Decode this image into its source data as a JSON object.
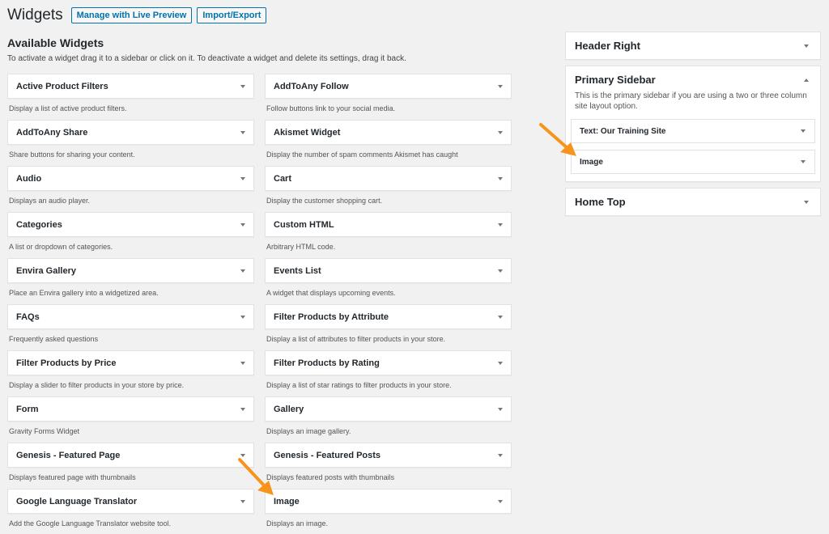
{
  "header": {
    "title": "Widgets",
    "manage_live_preview": "Manage with Live Preview",
    "import_export": "Import/Export"
  },
  "available": {
    "title": "Available Widgets",
    "description": "To activate a widget drag it to a sidebar or click on it. To deactivate a widget and delete its settings, drag it back.",
    "widgets": [
      {
        "title": "Active Product Filters",
        "desc": "Display a list of active product filters."
      },
      {
        "title": "AddToAny Follow",
        "desc": "Follow buttons link to your social media."
      },
      {
        "title": "AddToAny Share",
        "desc": "Share buttons for sharing your content."
      },
      {
        "title": "Akismet Widget",
        "desc": "Display the number of spam comments Akismet has caught"
      },
      {
        "title": "Audio",
        "desc": "Displays an audio player."
      },
      {
        "title": "Cart",
        "desc": "Display the customer shopping cart."
      },
      {
        "title": "Categories",
        "desc": "A list or dropdown of categories."
      },
      {
        "title": "Custom HTML",
        "desc": "Arbitrary HTML code."
      },
      {
        "title": "Envira Gallery",
        "desc": "Place an Envira gallery into a widgetized area."
      },
      {
        "title": "Events List",
        "desc": "A widget that displays upcoming events."
      },
      {
        "title": "FAQs",
        "desc": "Frequently asked questions"
      },
      {
        "title": "Filter Products by Attribute",
        "desc": "Display a list of attributes to filter products in your store."
      },
      {
        "title": "Filter Products by Price",
        "desc": "Display a slider to filter products in your store by price."
      },
      {
        "title": "Filter Products by Rating",
        "desc": "Display a list of star ratings to filter products in your store."
      },
      {
        "title": "Form",
        "desc": "Gravity Forms Widget"
      },
      {
        "title": "Gallery",
        "desc": "Displays an image gallery."
      },
      {
        "title": "Genesis - Featured Page",
        "desc": "Displays featured page with thumbnails"
      },
      {
        "title": "Genesis - Featured Posts",
        "desc": "Displays featured posts with thumbnails"
      },
      {
        "title": "Google Language Translator",
        "desc": "Add the Google Language Translator website tool."
      },
      {
        "title": "Image",
        "desc": "Displays an image."
      }
    ]
  },
  "sidebars": {
    "header_right": {
      "title": "Header Right"
    },
    "primary": {
      "title": "Primary Sidebar",
      "description": "This is the primary sidebar if you are using a two or three column site layout option.",
      "widgets": [
        {
          "title": "Text: Our Training Site"
        },
        {
          "title": "Image"
        }
      ]
    },
    "home_top": {
      "title": "Home Top"
    }
  },
  "colors": {
    "background": "#f1f1f1",
    "accent": "#0073aa",
    "callout_arrow": "#f7941d"
  }
}
